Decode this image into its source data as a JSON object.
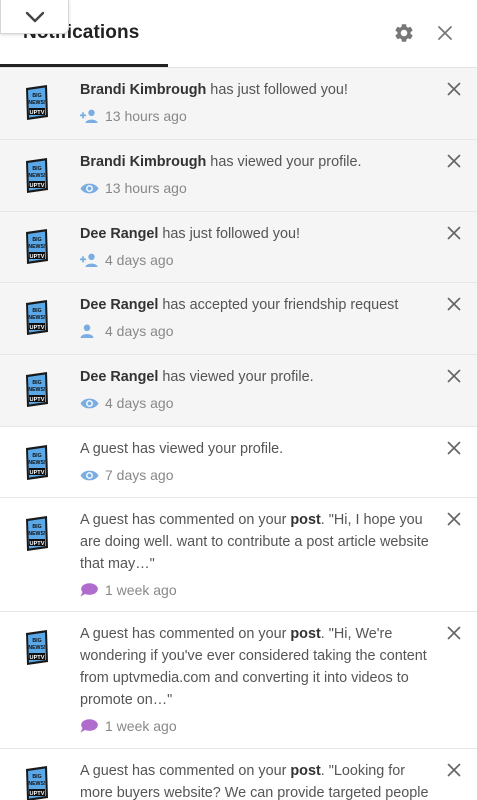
{
  "header": {
    "title": "Notifications"
  },
  "notifications": [
    {
      "name": "Brandi Kimbrough",
      "text": " has just followed you!",
      "time": "13 hours ago",
      "icon": "person-add-icon",
      "unread": true
    },
    {
      "name": "Brandi Kimbrough",
      "text": " has viewed your profile.",
      "time": "13 hours ago",
      "icon": "eye-icon",
      "unread": true
    },
    {
      "name": "Dee Rangel",
      "text": " has just followed you!",
      "time": "4 days ago",
      "icon": "person-add-icon",
      "unread": true
    },
    {
      "name": "Dee Rangel",
      "text": " has accepted your friendship request",
      "time": "4 days ago",
      "icon": "person-icon",
      "unread": true
    },
    {
      "name": "Dee Rangel",
      "text": " has viewed your profile.",
      "time": "4 days ago",
      "icon": "eye-icon",
      "unread": true
    },
    {
      "text": "A guest has viewed your profile.",
      "time": "7 days ago",
      "icon": "eye-icon",
      "unread": false
    },
    {
      "text": "A guest has commented on your ",
      "bold": "post",
      "quote": ". \"Hi, I hope you are doing well. want to contribute a post article website that may…\"",
      "time": "1 week ago",
      "icon": "comment-icon",
      "unread": false
    },
    {
      "text": "A guest has commented on your ",
      "bold": "post",
      "quote": ". \"Hi, We're wondering if you've ever considered taking the content from uptvmedia.com and converting it into videos to promote on…\"",
      "time": "1 week ago",
      "icon": "comment-icon",
      "unread": false
    },
    {
      "text": "A guest has commented on your ",
      "bold": "post",
      "quote": ". \"Looking for more buyers website? We can provide targeted people",
      "time": "",
      "icon": "comment-icon",
      "unread": false
    }
  ],
  "avatar": {
    "line1": "BIG",
    "line2": "NEWS!",
    "line3": "UPTV"
  },
  "colors": {
    "icon_blue": "#7aaee3",
    "icon_purple": "#b06ccc",
    "avatar_blue": "#5aa8e8",
    "text": "#555555",
    "name": "#333333"
  }
}
